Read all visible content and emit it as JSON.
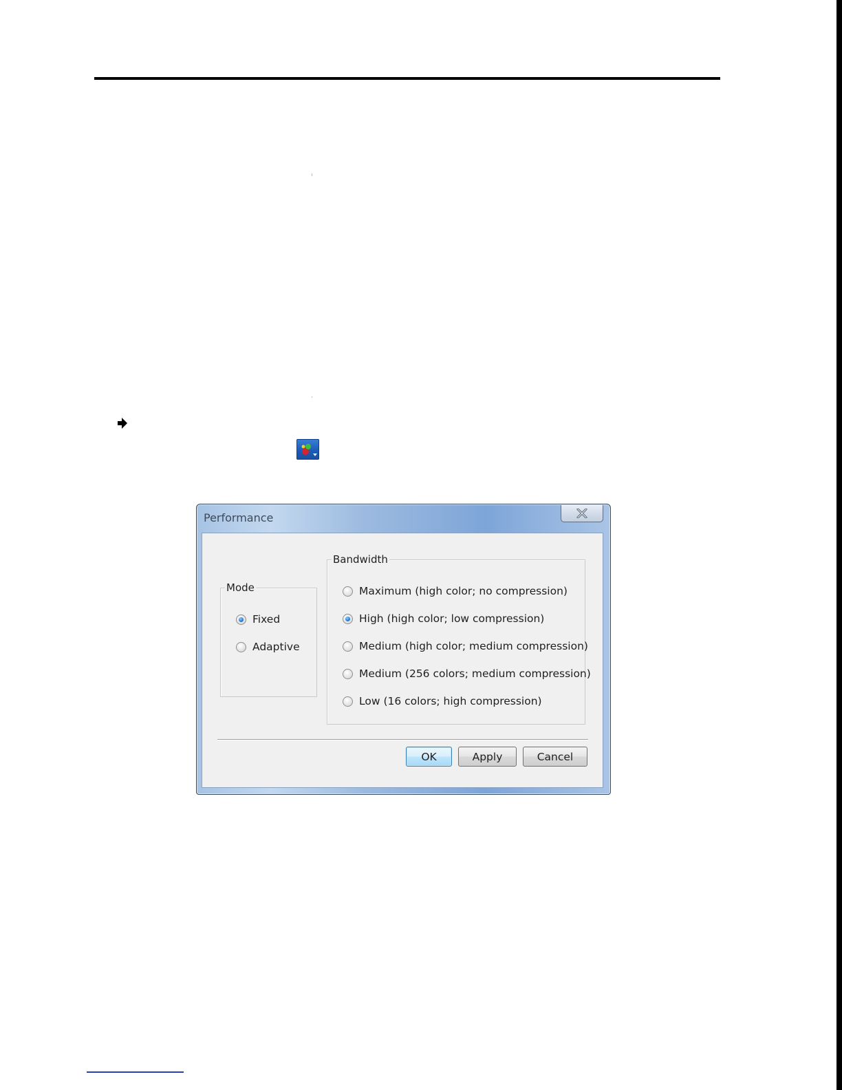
{
  "dialog": {
    "title": "Performance",
    "close_icon": "close-icon",
    "mode_group": {
      "title": "Mode",
      "options": [
        {
          "label": "Fixed",
          "checked": true
        },
        {
          "label": "Adaptive",
          "checked": false
        }
      ]
    },
    "bandwidth_group": {
      "title": "Bandwidth",
      "options": [
        {
          "label": "Maximum (high color; no compression)",
          "checked": false
        },
        {
          "label": "High (high color; low compression)",
          "checked": true
        },
        {
          "label": "Medium (high color; medium compression)",
          "checked": false
        },
        {
          "label": "Medium (256 colors; medium compression)",
          "checked": false
        },
        {
          "label": "Low (16 colors; high compression)",
          "checked": false
        }
      ]
    },
    "buttons": {
      "ok": "OK",
      "apply": "Apply",
      "cancel": "Cancel"
    }
  },
  "icons": {
    "bullet": "arrow-right-icon",
    "toolbar": "performance-toolbar-icon"
  }
}
